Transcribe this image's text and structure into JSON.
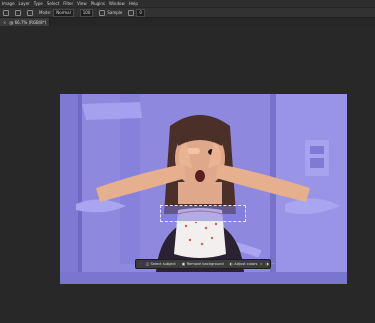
{
  "menubar": {
    "items": [
      "Image",
      "Layer",
      "Type",
      "Select",
      "Filter",
      "View",
      "Plugins",
      "Window",
      "Help"
    ]
  },
  "optionsbar": {
    "mode_label": "Mode:",
    "mode_value": "Normal",
    "opacity_value": "100",
    "sample_label": "Sample",
    "angle_value": "0"
  },
  "document": {
    "tab_title": "@ 66.7% (RGB/8*)"
  },
  "contextual_bar": {
    "select_subject": "Select subject",
    "remove_background": "Remove background",
    "adjust_colors": "Adjust colors"
  },
  "colors": {
    "backdrop": "#8e89df",
    "workspace": "#282828"
  }
}
